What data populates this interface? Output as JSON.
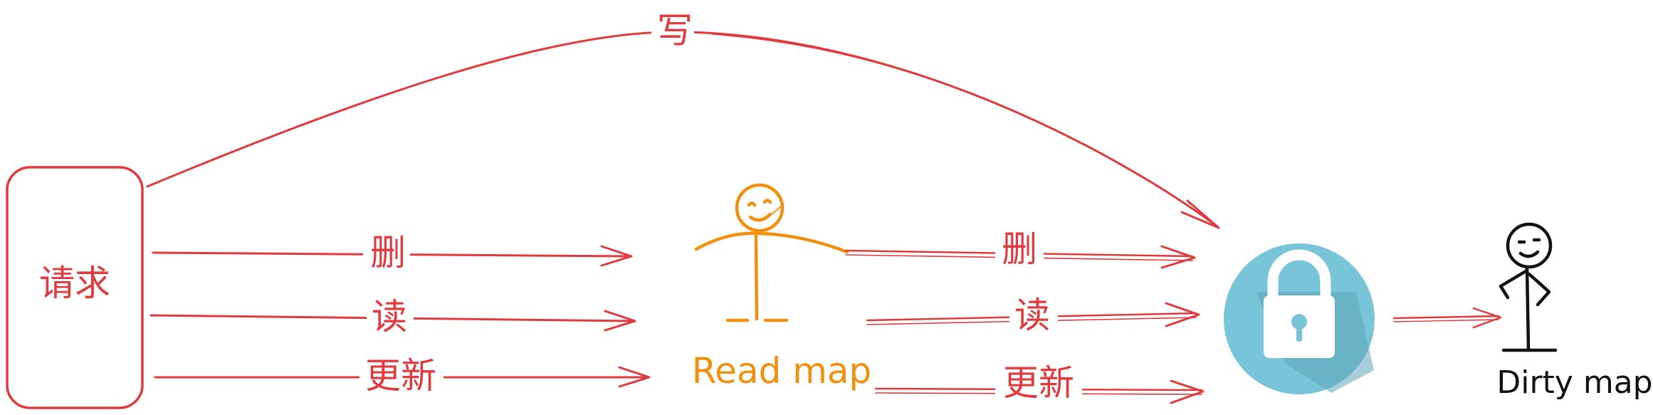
{
  "request": {
    "label": "请求"
  },
  "write_arrow": {
    "label": "写"
  },
  "left_arrows": [
    {
      "label": "删"
    },
    {
      "label": "读"
    },
    {
      "label": "更新"
    }
  ],
  "right_arrows": [
    {
      "label": "删"
    },
    {
      "label": "读"
    },
    {
      "label": "更新"
    }
  ],
  "read_map": {
    "label": "Read map",
    "color": "#f0900f"
  },
  "dirty_map": {
    "label": "Dirty map",
    "color": "#111111"
  },
  "lock": {
    "icon": "lock-icon",
    "circle_color": "#78c4d8",
    "shadow_color": "#5ea6b8"
  },
  "colors": {
    "arrow": "#e0393e"
  }
}
